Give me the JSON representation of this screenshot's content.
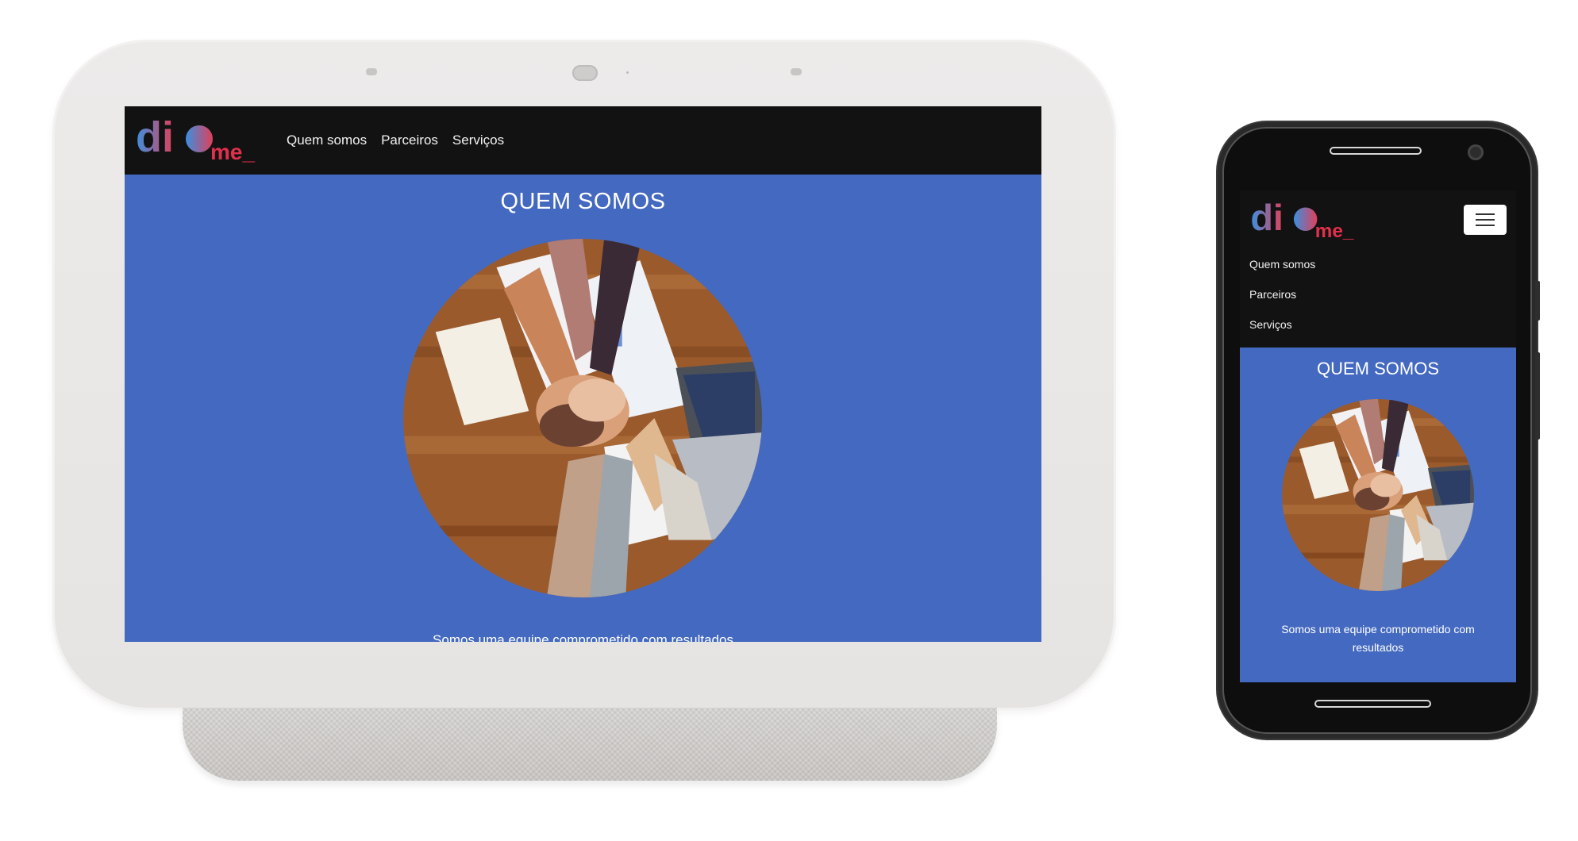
{
  "logo": {
    "text_main": "di",
    "text_suffix": "me_"
  },
  "nav": {
    "items": [
      "Quem somos",
      "Parceiros",
      "Serviços"
    ]
  },
  "section": {
    "title": "QUEM SOMOS",
    "caption": "Somos uma equipe comprometido com resultados"
  },
  "icons": {
    "menu": "hamburger-menu-icon"
  },
  "colors": {
    "navbar": "#121212",
    "section_bg": "#4469c0",
    "logo_gradient_start": "#3b8fe0",
    "logo_gradient_end": "#e0405a",
    "logo_suffix": "#e0304c"
  }
}
